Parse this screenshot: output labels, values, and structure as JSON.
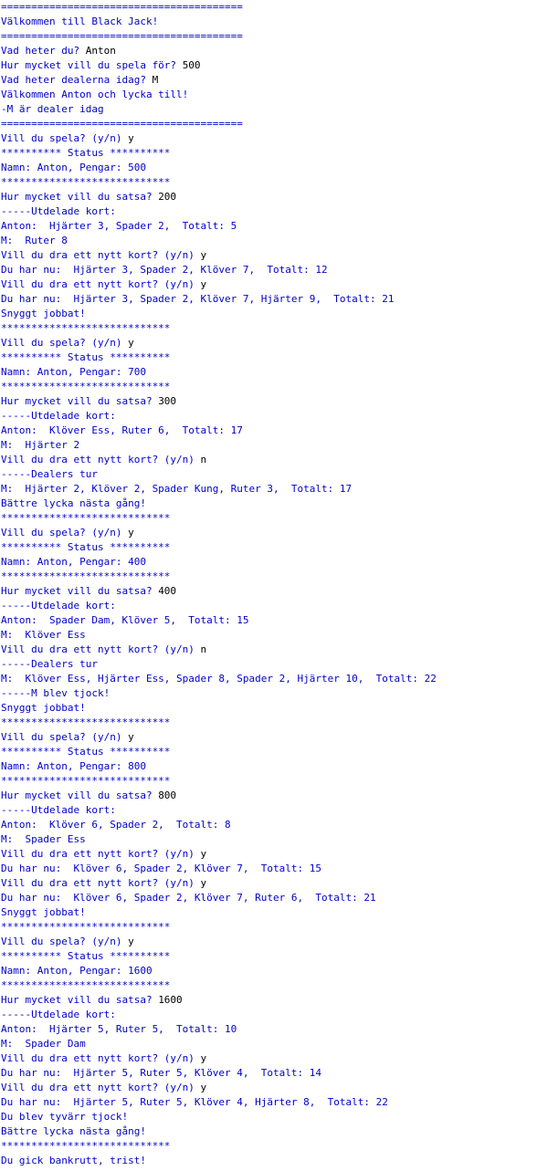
{
  "console": {
    "colors": {
      "program_text": "#0000cc",
      "user_input": "#000000",
      "background": "#ffffff"
    },
    "lines": [
      [
        {
          "t": "========================================",
          "k": "out"
        }
      ],
      [
        {
          "t": "Välkommen till Black Jack!",
          "k": "out"
        }
      ],
      [
        {
          "t": "========================================",
          "k": "out"
        }
      ],
      [
        {
          "t": "Vad heter du? ",
          "k": "prompt"
        },
        {
          "t": "Anton",
          "k": "input"
        }
      ],
      [
        {
          "t": "Hur mycket vill du spela för? ",
          "k": "prompt"
        },
        {
          "t": "500",
          "k": "input"
        }
      ],
      [
        {
          "t": "Vad heter dealerna idag? ",
          "k": "prompt"
        },
        {
          "t": "M",
          "k": "input"
        }
      ],
      [
        {
          "t": "Välkommen Anton och lycka till!",
          "k": "out"
        }
      ],
      [
        {
          "t": "-M är dealer idag",
          "k": "out"
        }
      ],
      [
        {
          "t": "========================================",
          "k": "out"
        }
      ],
      [
        {
          "t": "Vill du spela? (y/n) ",
          "k": "prompt"
        },
        {
          "t": "y",
          "k": "input"
        }
      ],
      [
        {
          "t": "********** Status **********",
          "k": "out"
        }
      ],
      [
        {
          "t": "Namn: Anton, Pengar: 500",
          "k": "out"
        }
      ],
      [
        {
          "t": "****************************",
          "k": "out"
        }
      ],
      [
        {
          "t": "Hur mycket vill du satsa? ",
          "k": "prompt"
        },
        {
          "t": "200",
          "k": "input"
        }
      ],
      [
        {
          "t": "-----Utdelade kort:",
          "k": "out"
        }
      ],
      [
        {
          "t": "Anton:  Hjärter 3, Spader 2,  Totalt: 5",
          "k": "out"
        }
      ],
      [
        {
          "t": "M:  Ruter 8",
          "k": "out"
        }
      ],
      [
        {
          "t": "Vill du dra ett nytt kort? (y/n) ",
          "k": "prompt"
        },
        {
          "t": "y",
          "k": "input"
        }
      ],
      [
        {
          "t": "Du har nu:  Hjärter 3, Spader 2, Klöver 7,  Totalt: 12",
          "k": "out"
        }
      ],
      [
        {
          "t": "Vill du dra ett nytt kort? (y/n) ",
          "k": "prompt"
        },
        {
          "t": "y",
          "k": "input"
        }
      ],
      [
        {
          "t": "Du har nu:  Hjärter 3, Spader 2, Klöver 7, Hjärter 9,  Totalt: 21",
          "k": "out"
        }
      ],
      [
        {
          "t": "Snyggt jobbat!",
          "k": "out"
        }
      ],
      [
        {
          "t": "****************************",
          "k": "out"
        }
      ],
      [
        {
          "t": "Vill du spela? (y/n) ",
          "k": "prompt"
        },
        {
          "t": "y",
          "k": "input"
        }
      ],
      [
        {
          "t": "********** Status **********",
          "k": "out"
        }
      ],
      [
        {
          "t": "Namn: Anton, Pengar: 700",
          "k": "out"
        }
      ],
      [
        {
          "t": "****************************",
          "k": "out"
        }
      ],
      [
        {
          "t": "Hur mycket vill du satsa? ",
          "k": "prompt"
        },
        {
          "t": "300",
          "k": "input"
        }
      ],
      [
        {
          "t": "-----Utdelade kort:",
          "k": "out"
        }
      ],
      [
        {
          "t": "Anton:  Klöver Ess, Ruter 6,  Totalt: 17",
          "k": "out"
        }
      ],
      [
        {
          "t": "M:  Hjärter 2",
          "k": "out"
        }
      ],
      [
        {
          "t": "Vill du dra ett nytt kort? (y/n) ",
          "k": "prompt"
        },
        {
          "t": "n",
          "k": "input"
        }
      ],
      [
        {
          "t": "-----Dealers tur",
          "k": "out"
        }
      ],
      [
        {
          "t": "M:  Hjärter 2, Klöver 2, Spader Kung, Ruter 3,  Totalt: 17",
          "k": "out"
        }
      ],
      [
        {
          "t": "Bättre lycka nästa gång!",
          "k": "out"
        }
      ],
      [
        {
          "t": "****************************",
          "k": "out"
        }
      ],
      [
        {
          "t": "Vill du spela? (y/n) ",
          "k": "prompt"
        },
        {
          "t": "y",
          "k": "input"
        }
      ],
      [
        {
          "t": "********** Status **********",
          "k": "out"
        }
      ],
      [
        {
          "t": "Namn: Anton, Pengar: 400",
          "k": "out"
        }
      ],
      [
        {
          "t": "****************************",
          "k": "out"
        }
      ],
      [
        {
          "t": "Hur mycket vill du satsa? ",
          "k": "prompt"
        },
        {
          "t": "400",
          "k": "input"
        }
      ],
      [
        {
          "t": "-----Utdelade kort:",
          "k": "out"
        }
      ],
      [
        {
          "t": "Anton:  Spader Dam, Klöver 5,  Totalt: 15",
          "k": "out"
        }
      ],
      [
        {
          "t": "M:  Klöver Ess",
          "k": "out"
        }
      ],
      [
        {
          "t": "Vill du dra ett nytt kort? (y/n) ",
          "k": "prompt"
        },
        {
          "t": "n",
          "k": "input"
        }
      ],
      [
        {
          "t": "-----Dealers tur",
          "k": "out"
        }
      ],
      [
        {
          "t": "M:  Klöver Ess, Hjärter Ess, Spader 8, Spader 2, Hjärter 10,  Totalt: 22",
          "k": "out"
        }
      ],
      [
        {
          "t": "-----M blev tjock!",
          "k": "out"
        }
      ],
      [
        {
          "t": "Snyggt jobbat!",
          "k": "out"
        }
      ],
      [
        {
          "t": "****************************",
          "k": "out"
        }
      ],
      [
        {
          "t": "Vill du spela? (y/n) ",
          "k": "prompt"
        },
        {
          "t": "y",
          "k": "input"
        }
      ],
      [
        {
          "t": "********** Status **********",
          "k": "out"
        }
      ],
      [
        {
          "t": "Namn: Anton, Pengar: 800",
          "k": "out"
        }
      ],
      [
        {
          "t": "****************************",
          "k": "out"
        }
      ],
      [
        {
          "t": "Hur mycket vill du satsa? ",
          "k": "prompt"
        },
        {
          "t": "800",
          "k": "input"
        }
      ],
      [
        {
          "t": "-----Utdelade kort:",
          "k": "out"
        }
      ],
      [
        {
          "t": "Anton:  Klöver 6, Spader 2,  Totalt: 8",
          "k": "out"
        }
      ],
      [
        {
          "t": "M:  Spader Ess",
          "k": "out"
        }
      ],
      [
        {
          "t": "Vill du dra ett nytt kort? (y/n) ",
          "k": "prompt"
        },
        {
          "t": "y",
          "k": "input"
        }
      ],
      [
        {
          "t": "Du har nu:  Klöver 6, Spader 2, Klöver 7,  Totalt: 15",
          "k": "out"
        }
      ],
      [
        {
          "t": "Vill du dra ett nytt kort? (y/n) ",
          "k": "prompt"
        },
        {
          "t": "y",
          "k": "input"
        }
      ],
      [
        {
          "t": "Du har nu:  Klöver 6, Spader 2, Klöver 7, Ruter 6,  Totalt: 21",
          "k": "out"
        }
      ],
      [
        {
          "t": "Snyggt jobbat!",
          "k": "out"
        }
      ],
      [
        {
          "t": "****************************",
          "k": "out"
        }
      ],
      [
        {
          "t": "Vill du spela? (y/n) ",
          "k": "prompt"
        },
        {
          "t": "y",
          "k": "input"
        }
      ],
      [
        {
          "t": "********** Status **********",
          "k": "out"
        }
      ],
      [
        {
          "t": "Namn: Anton, Pengar: 1600",
          "k": "out"
        }
      ],
      [
        {
          "t": "****************************",
          "k": "out"
        }
      ],
      [
        {
          "t": "Hur mycket vill du satsa? ",
          "k": "prompt"
        },
        {
          "t": "1600",
          "k": "input"
        }
      ],
      [
        {
          "t": "-----Utdelade kort:",
          "k": "out"
        }
      ],
      [
        {
          "t": "Anton:  Hjärter 5, Ruter 5,  Totalt: 10",
          "k": "out"
        }
      ],
      [
        {
          "t": "M:  Spader Dam",
          "k": "out"
        }
      ],
      [
        {
          "t": "Vill du dra ett nytt kort? (y/n) ",
          "k": "prompt"
        },
        {
          "t": "y",
          "k": "input"
        }
      ],
      [
        {
          "t": "Du har nu:  Hjärter 5, Ruter 5, Klöver 4,  Totalt: 14",
          "k": "out"
        }
      ],
      [
        {
          "t": "Vill du dra ett nytt kort? (y/n) ",
          "k": "prompt"
        },
        {
          "t": "y",
          "k": "input"
        }
      ],
      [
        {
          "t": "Du har nu:  Hjärter 5, Ruter 5, Klöver 4, Hjärter 8,  Totalt: 22",
          "k": "out"
        }
      ],
      [
        {
          "t": "Du blev tyvärr tjock!",
          "k": "out"
        }
      ],
      [
        {
          "t": "Bättre lycka nästa gång!",
          "k": "out"
        }
      ],
      [
        {
          "t": "****************************",
          "k": "out"
        }
      ],
      [
        {
          "t": "Du gick bankrutt, trist!",
          "k": "out"
        }
      ]
    ]
  }
}
